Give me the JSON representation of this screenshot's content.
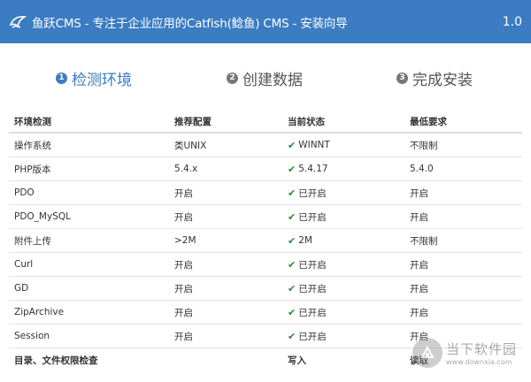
{
  "header": {
    "title": "鱼跃CMS - 专注于企业应用的Catfish(鲶鱼) CMS - 安装向导",
    "version": "1.0"
  },
  "steps": [
    {
      "num": "1",
      "label": "检测环境",
      "active": true
    },
    {
      "num": "2",
      "label": "创建数据",
      "active": false
    },
    {
      "num": "3",
      "label": "完成安装",
      "active": false
    }
  ],
  "table": {
    "headers": [
      "环境检测",
      "推荐配置",
      "当前状态",
      "最低要求"
    ],
    "rows": [
      {
        "name": "操作系统",
        "recommended": "类UNIX",
        "current": "WINNT",
        "minimum": "不限制"
      },
      {
        "name": "PHP版本",
        "recommended": "5.4.x",
        "current": "5.4.17",
        "minimum": "5.4.0"
      },
      {
        "name": "PDO",
        "recommended": "开启",
        "current": "已开启",
        "minimum": "开启"
      },
      {
        "name": "PDO_MySQL",
        "recommended": "开启",
        "current": "已开启",
        "minimum": "开启"
      },
      {
        "name": "附件上传",
        "recommended": ">2M",
        "current": "2M",
        "minimum": "不限制"
      },
      {
        "name": "Curl",
        "recommended": "开启",
        "current": "已开启",
        "minimum": "开启"
      },
      {
        "name": "GD",
        "recommended": "开启",
        "current": "已开启",
        "minimum": "开启"
      },
      {
        "name": "ZipArchive",
        "recommended": "开启",
        "current": "已开启",
        "minimum": "开启"
      },
      {
        "name": "Session",
        "recommended": "开启",
        "current": "已开启",
        "minimum": "开启"
      }
    ],
    "permission_headers": [
      "目录、文件权限检查",
      "写入",
      "读取"
    ]
  },
  "watermark": {
    "cn": "当下软件园",
    "en": "www.downxia.com"
  },
  "colors": {
    "header_bg": "#3b7cc2",
    "active_step": "#3b7cc2",
    "check": "#2e8b2e"
  }
}
